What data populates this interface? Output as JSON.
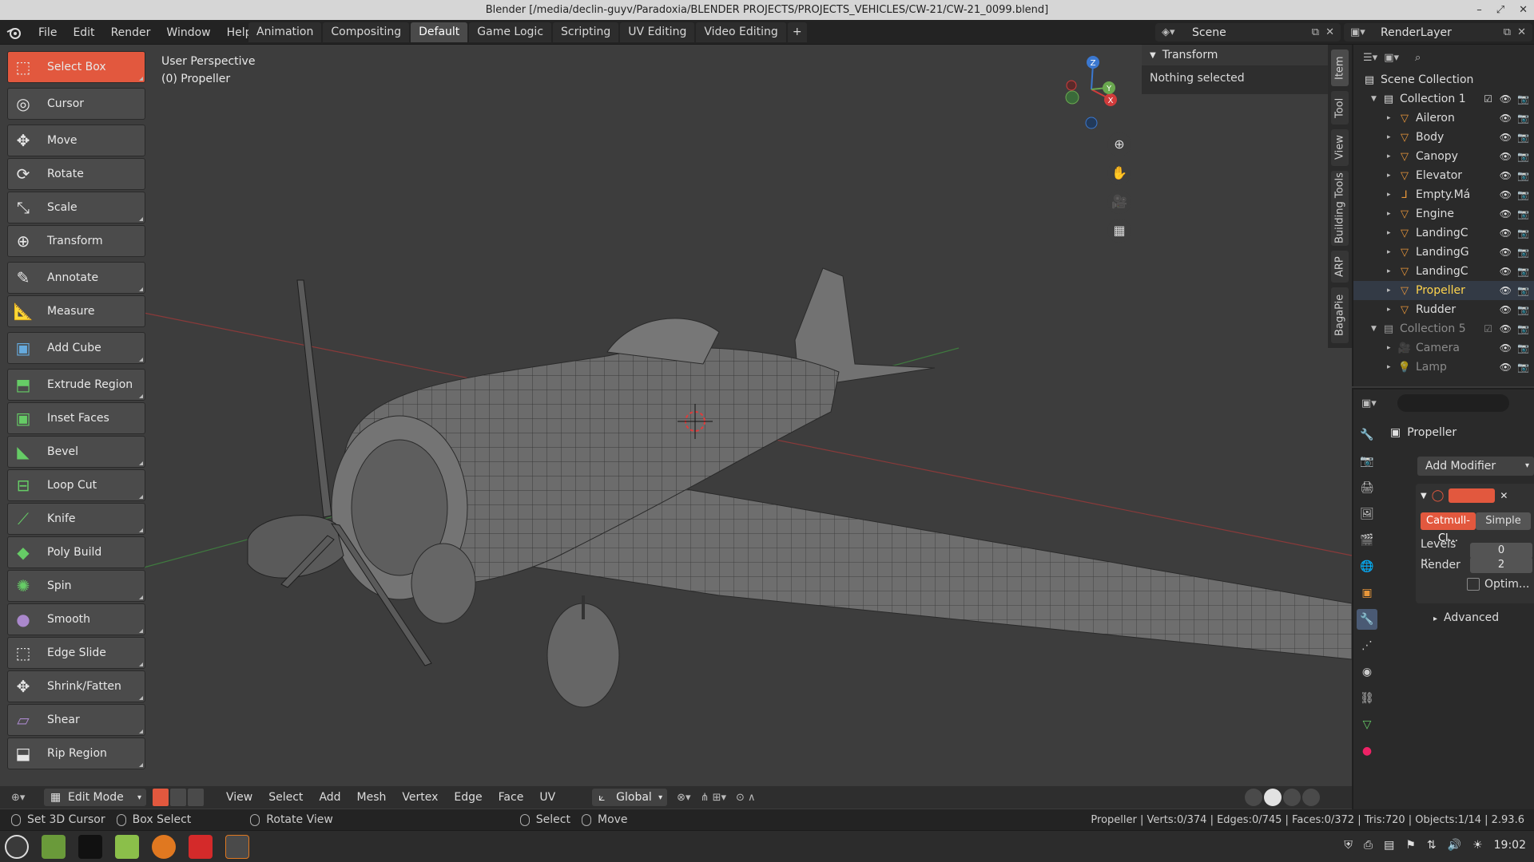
{
  "window": {
    "title": "Blender [/media/declin-guyv/Paradoxia/BLENDER PROJECTS/PROJECTS_VEHICLES/CW-21/CW-21_0099.blend]"
  },
  "menu": [
    "File",
    "Edit",
    "Render",
    "Window",
    "Help"
  ],
  "workspaces": [
    "Animation",
    "Compositing",
    "Default",
    "Game Logic",
    "Scripting",
    "UV Editing",
    "Video Editing"
  ],
  "active_workspace": "Default",
  "scene_name": "Scene",
  "render_layer": "RenderLayer",
  "viewport": {
    "view_name": "User Perspective",
    "object_label": "(0) Propeller"
  },
  "tools": [
    {
      "label": "Select Box",
      "icon": "select-box-icon"
    },
    {
      "label": "Cursor",
      "icon": "cursor-icon"
    },
    {
      "label": "Move",
      "icon": "move-icon"
    },
    {
      "label": "Rotate",
      "icon": "rotate-icon"
    },
    {
      "label": "Scale",
      "icon": "scale-icon"
    },
    {
      "label": "Transform",
      "icon": "transform-icon"
    },
    {
      "label": "Annotate",
      "icon": "annotate-icon"
    },
    {
      "label": "Measure",
      "icon": "measure-icon"
    },
    {
      "label": "Add Cube",
      "icon": "add-cube-icon"
    },
    {
      "label": "Extrude Region",
      "icon": "extrude-icon"
    },
    {
      "label": "Inset Faces",
      "icon": "inset-icon"
    },
    {
      "label": "Bevel",
      "icon": "bevel-icon"
    },
    {
      "label": "Loop Cut",
      "icon": "loop-cut-icon"
    },
    {
      "label": "Knife",
      "icon": "knife-icon"
    },
    {
      "label": "Poly Build",
      "icon": "poly-build-icon"
    },
    {
      "label": "Spin",
      "icon": "spin-icon"
    },
    {
      "label": "Smooth",
      "icon": "smooth-icon"
    },
    {
      "label": "Edge Slide",
      "icon": "edge-slide-icon"
    },
    {
      "label": "Shrink/Fatten",
      "icon": "shrink-fatten-icon"
    },
    {
      "label": "Shear",
      "icon": "shear-icon"
    },
    {
      "label": "Rip Region",
      "icon": "rip-region-icon"
    }
  ],
  "npanel": {
    "header": "Transform",
    "body": "Nothing selected"
  },
  "sidebar_tabs": [
    "Item",
    "Tool",
    "View",
    "Building Tools",
    "ARP",
    "BagaPie"
  ],
  "viewport_header": {
    "mode": "Edit Mode",
    "menus": [
      "View",
      "Select",
      "Add",
      "Mesh",
      "Vertex",
      "Edge",
      "Face",
      "UV"
    ],
    "orientation": "Global"
  },
  "outliner": {
    "root": "Scene Collection",
    "collections": [
      {
        "name": "Collection 1",
        "items": [
          "Aileron",
          "Body",
          "Canopy",
          "Elevator",
          "Empty.Má",
          "Engine",
          "LandingC",
          "LandingG",
          "LandingC",
          "Propeller",
          "Rudder"
        ]
      },
      {
        "name": "Collection 5",
        "items": [
          "Camera",
          "Lamp"
        ]
      }
    ],
    "selected": "Propeller"
  },
  "properties": {
    "object_name": "Propeller",
    "add_modifier": "Add Modifier",
    "modifier": {
      "tab_catmull": "Catmull-Cl...",
      "tab_simple": "Simple",
      "levels_label": "Levels ...",
      "levels_value": "0",
      "render_label": "Render",
      "render_value": "2",
      "optimal_label": "Optim...",
      "advanced_label": "Advanced"
    }
  },
  "statusbar": {
    "hints": [
      "Set 3D Cursor",
      "Box Select",
      "Rotate View",
      "Select",
      "Move"
    ],
    "stats": "Propeller | Verts:0/374 | Edges:0/745 | Faces:0/372 | Tris:720 | Objects:1/14 | 2.93.6"
  },
  "taskbar": {
    "clock": "19:02"
  },
  "colors": {
    "accent": "#e2583e",
    "selected_text": "#ffd44d",
    "object_icon": "#e8963a"
  }
}
